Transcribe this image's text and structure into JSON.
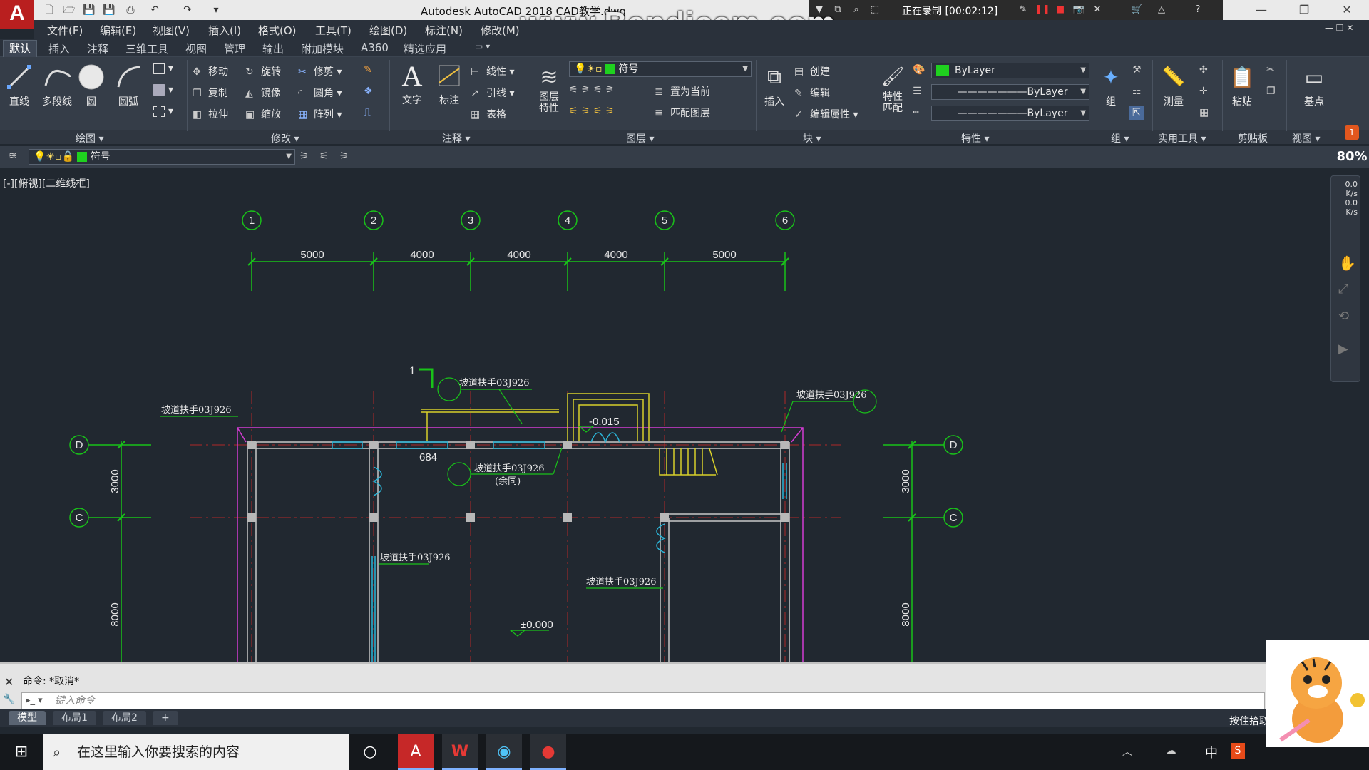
{
  "window": {
    "title": "Autodesk AutoCAD 2018    CAD教学.dwg",
    "watermark": "www.Bandicam.com",
    "recording": "正在录制 [00:02:12]"
  },
  "menu": [
    "文件(F)",
    "编辑(E)",
    "视图(V)",
    "插入(I)",
    "格式(O)",
    "工具(T)",
    "绘图(D)",
    "标注(N)",
    "修改(M)"
  ],
  "ribbon_tabs": [
    "默认",
    "插入",
    "注释",
    "三维工具",
    "视图",
    "管理",
    "输出",
    "附加模块",
    "A360",
    "精选应用"
  ],
  "panels": {
    "draw": {
      "title": "绘图",
      "line": "直线",
      "polyline": "多段线",
      "circle": "圆",
      "arc": "圆弧"
    },
    "modify": {
      "title": "修改",
      "move": "移动",
      "rotate": "旋转",
      "trim": "修剪",
      "copy": "复制",
      "mirror": "镜像",
      "fillet": "圆角",
      "stretch": "拉伸",
      "scale": "缩放",
      "array": "阵列"
    },
    "annotation": {
      "title": "注释",
      "text": "文字",
      "dimension": "标注",
      "linear": "线性",
      "leader": "引线",
      "table": "表格"
    },
    "layers": {
      "title": "图层",
      "layer_properties": "图层\n特性",
      "current_layer": "符号",
      "set_current": "置为当前",
      "match_layer": "匹配图层"
    },
    "block": {
      "title": "块",
      "insert": "插入",
      "create": "创建",
      "edit": "编辑",
      "edit_attributes": "编辑属性"
    },
    "properties": {
      "title": "特性",
      "match": "特性\n匹配",
      "color": "ByLayer",
      "linetype": "ByLayer",
      "lineweight": "ByLayer"
    },
    "groups": {
      "title": "组",
      "group": "组"
    },
    "utilities": {
      "title": "实用工具",
      "measure": "测量"
    },
    "clipboard": {
      "title": "剪贴板",
      "paste": "粘贴"
    },
    "view": {
      "title": "视图",
      "base": "基点"
    }
  },
  "layer_toolbar": {
    "layer": "符号"
  },
  "viewport_label": "[-][俯视][二维线框]",
  "zoom_level": "80%",
  "net_speed": [
    "0.0",
    "K/s",
    "0.0",
    "K/s"
  ],
  "drawing": {
    "axis_top": [
      "1",
      "2",
      "3",
      "4",
      "5",
      "6"
    ],
    "dims_top": [
      "5000",
      "4000",
      "4000",
      "4000",
      "5000"
    ],
    "axis_side": [
      "D",
      "C"
    ],
    "dims_side": [
      "3000",
      "8000"
    ],
    "labels": {
      "railing1": "坡道扶手03J926",
      "railing2": "坡道扶手03J926",
      "railing3": "坡道扶手03J926",
      "railing4": "坡道扶手03J926",
      "railing5": "坡道扶手03J926",
      "railing6": "坡道扶手03J926",
      "same": "(余同)",
      "dim684": "684",
      "elev_neg": "-0.015",
      "elev_zero": "±0.000",
      "section": "1"
    }
  },
  "command": {
    "history": "命令:  *取消*",
    "placeholder": "键入命令"
  },
  "layout_tabs": [
    "模型",
    "布局1",
    "布局2",
    "+"
  ],
  "status_right": "按住拾取",
  "taskbar": {
    "search": "在这里输入你要搜索的内容",
    "lang": "中"
  },
  "colors": {
    "canvas": "#212830",
    "axis_green": "#19c219",
    "wall_gray": "#c8c8c8",
    "magenta": "#d23cd2",
    "yellow": "#d8d02a",
    "cyan": "#2bb5d8",
    "red_center": "#b02828"
  }
}
